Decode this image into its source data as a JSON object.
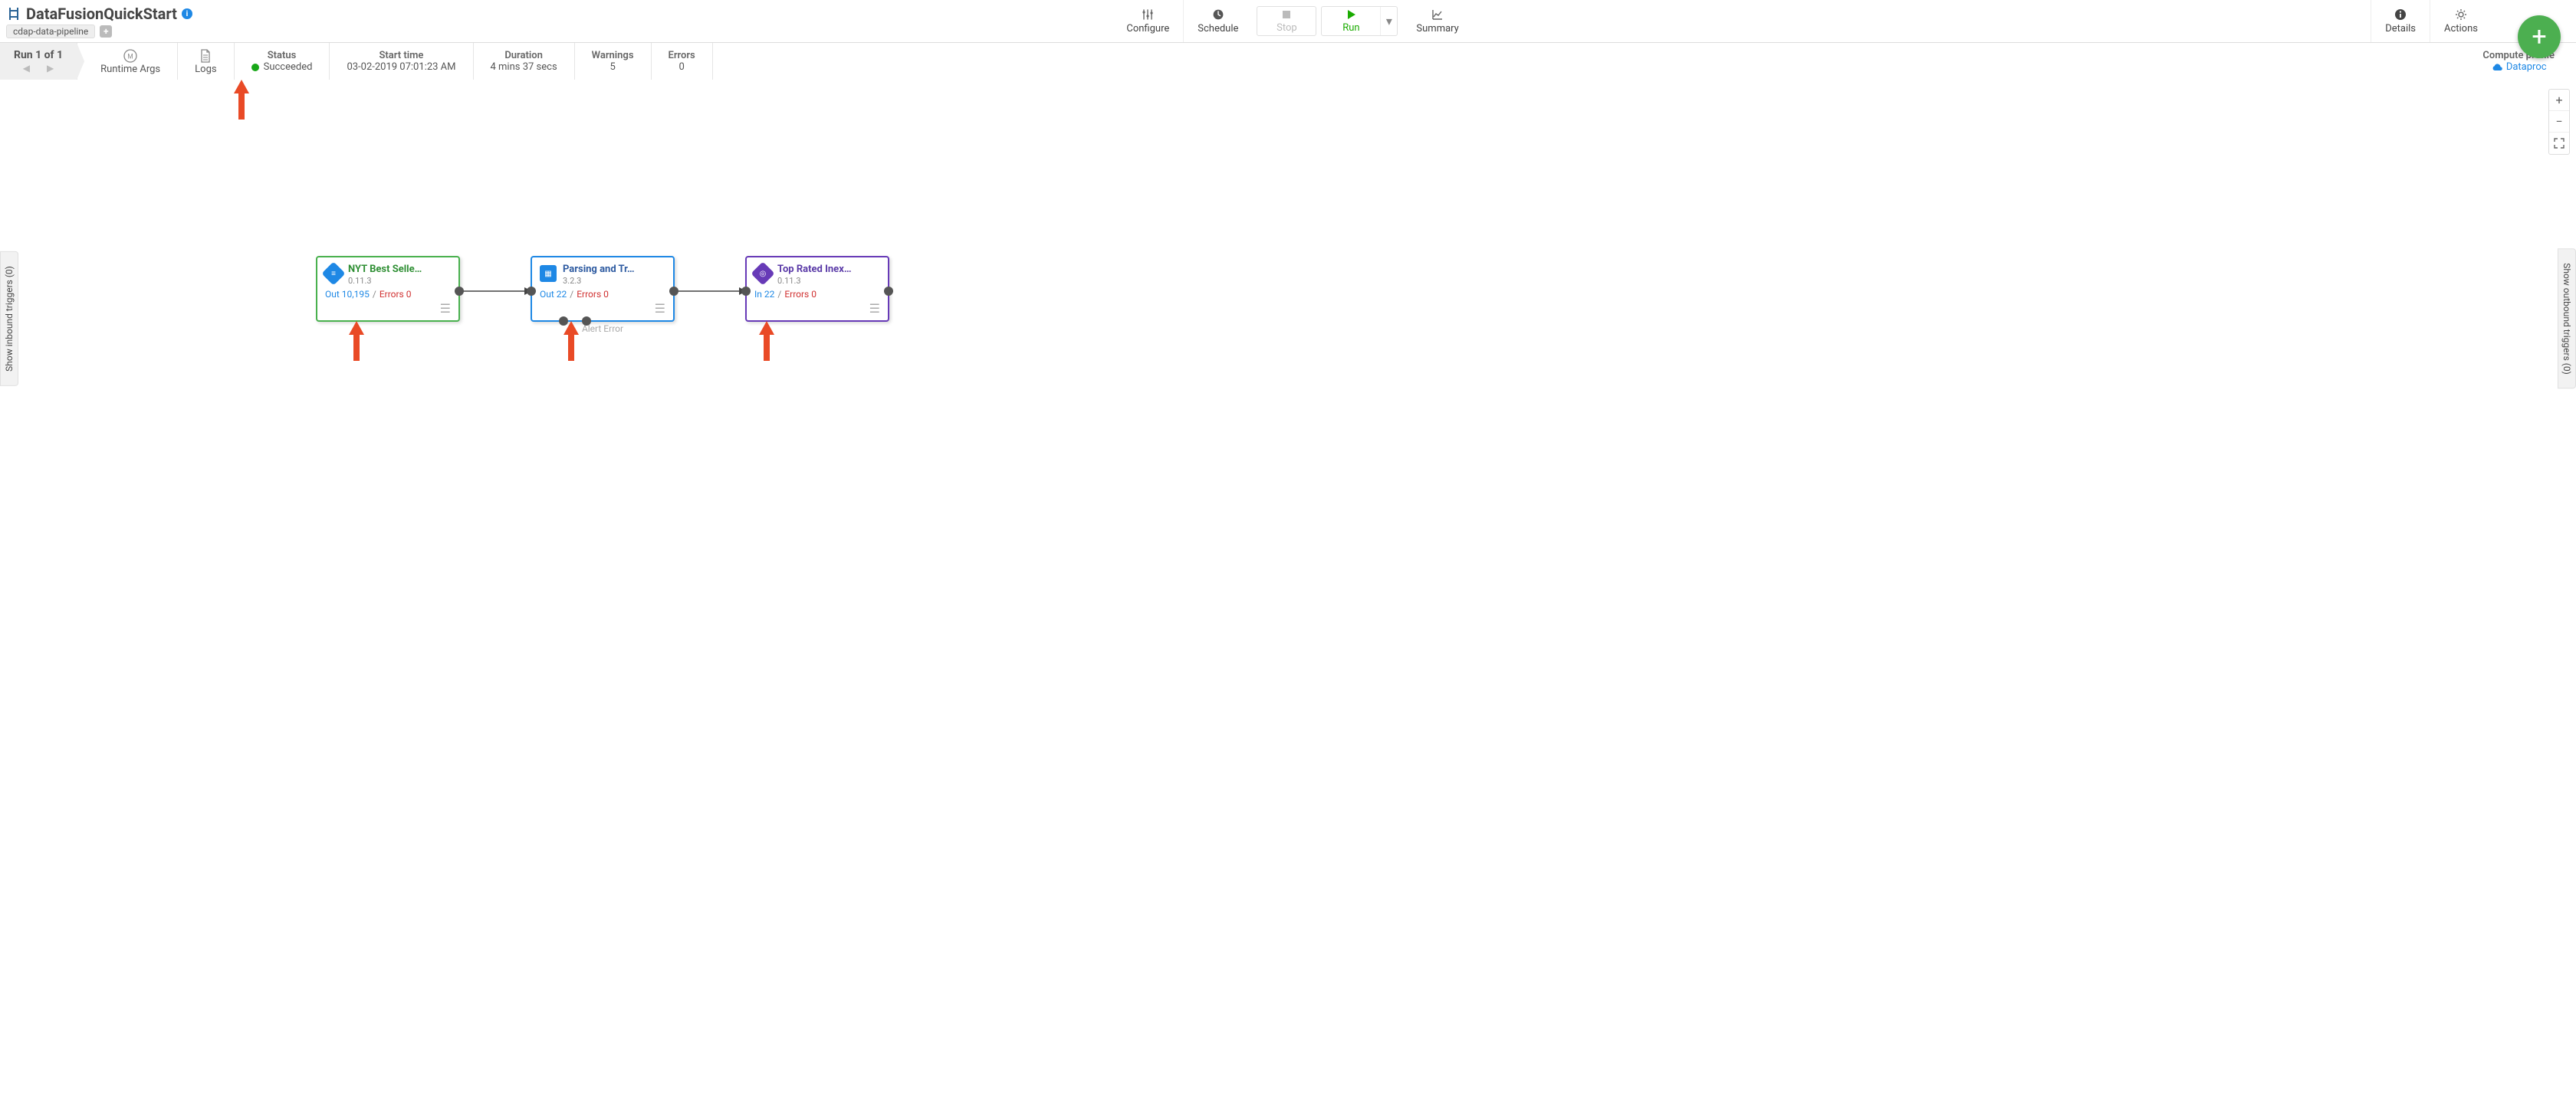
{
  "header": {
    "title": "DataFusionQuickStart",
    "pipeline_type": "cdap-data-pipeline"
  },
  "toolbar": {
    "configure": "Configure",
    "schedule": "Schedule",
    "stop": "Stop",
    "run": "Run",
    "summary": "Summary",
    "details": "Details",
    "actions": "Actions"
  },
  "runbar": {
    "run_count_label": "Run 1 of 1",
    "runtime_args": "Runtime Args",
    "logs": "Logs",
    "status_label": "Status",
    "status_value": "Succeeded",
    "start_label": "Start time",
    "start_value": "03-02-2019 07:01:23 AM",
    "duration_label": "Duration",
    "duration_value": "4 mins 37 secs",
    "warnings_label": "Warnings",
    "warnings_value": "5",
    "errors_label": "Errors",
    "errors_value": "0",
    "compute_label": "Compute profile",
    "compute_value": "Dataproc"
  },
  "side_tabs": {
    "inbound": "Show inbound triggers (0)",
    "outbound": "Show outbound triggers (0)"
  },
  "nodes": [
    {
      "title": "NYT Best Selle…",
      "version": "0.11.3",
      "stat_out": "Out 10,195",
      "stat_err": "Errors 0"
    },
    {
      "title": "Parsing and Tr…",
      "version": "3.2.3",
      "stat_out": "Out 22",
      "stat_err": "Errors 0",
      "extra": "Alert      Error"
    },
    {
      "title": "Top Rated Inex…",
      "version": "0.11.3",
      "stat_out": "In 22",
      "stat_err": "Errors 0"
    }
  ]
}
